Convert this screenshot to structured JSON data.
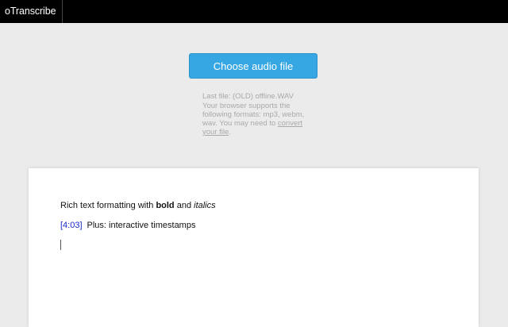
{
  "app": {
    "brand": "oTranscribe"
  },
  "file_picker": {
    "button_label": "Choose audio file",
    "last_file": "Last file: (OLD) offline.WAV",
    "support_text": "Your browser supports the following formats: mp3, webm, wav. You may need to",
    "convert_link": "convert your file",
    "support_end": "."
  },
  "editor": {
    "line1_prefix": "Rich text formatting with ",
    "line1_bold": "bold",
    "line1_mid": " and ",
    "line1_italic": "italics",
    "timestamp": "[4:03]",
    "line2_text": "Plus: interactive timestamps"
  },
  "colors": {
    "topbar": "#000000",
    "button": "#37a7e4",
    "timestamp": "#1a26c9",
    "background": "#ebebeb"
  }
}
